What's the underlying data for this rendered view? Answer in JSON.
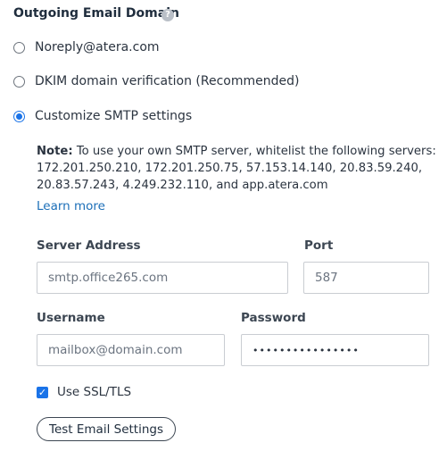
{
  "section": {
    "title": "Outgoing Email Domain",
    "help_icon_glyph": "?"
  },
  "options": [
    {
      "label": "Noreply@atera.com",
      "selected": false
    },
    {
      "label": "DKIM domain verification (Recommended)",
      "selected": false
    },
    {
      "label": "Customize SMTP settings",
      "selected": true
    }
  ],
  "note": {
    "prefix": "Note:",
    "text": " To use your own SMTP server, whitelist the following servers: 172.201.250.210, 172.201.250.75, 57.153.14.140, 20.83.59.240, 20.83.57.243, 4.249.232.110, and app.atera.com",
    "learn_more": "Learn more"
  },
  "smtp": {
    "server_address_label": "Server Address",
    "server_address_placeholder": "smtp.office265.com",
    "port_label": "Port",
    "port_placeholder": "587",
    "username_label": "Username",
    "username_placeholder": "mailbox@domain.com",
    "password_label": "Password",
    "password_value": "••••••••••••••••"
  },
  "ssl": {
    "label": "Use SSL/TLS",
    "checked": true,
    "check_glyph": "✓"
  },
  "test_button_label": "Test Email Settings",
  "colors": {
    "accent": "#1a73e8",
    "link": "#1c6fb8",
    "text": "#2b3440"
  }
}
